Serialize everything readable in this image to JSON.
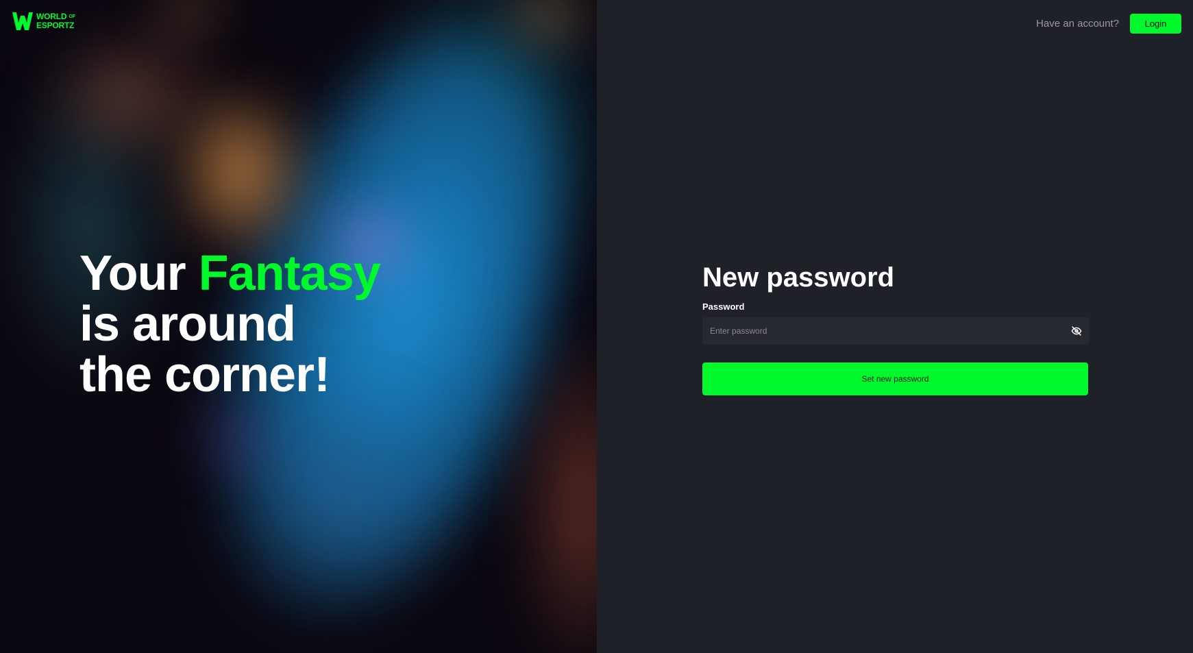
{
  "brand": {
    "logo_line1": "WORLD",
    "logo_of": "OF",
    "logo_line2": "ESPORTZ",
    "accent_color": "#00f92d"
  },
  "hero": {
    "line1_prefix": "Your ",
    "line1_accent": "Fantasy",
    "line2": "is around",
    "line3": "the corner!"
  },
  "topbar": {
    "prompt": "Have an account?",
    "login_label": "Login"
  },
  "form": {
    "title": "New password",
    "password_label": "Password",
    "password_placeholder": "Enter password",
    "password_value": "",
    "toggle_icon": "eye-off-icon",
    "submit_label": "Set new password"
  }
}
